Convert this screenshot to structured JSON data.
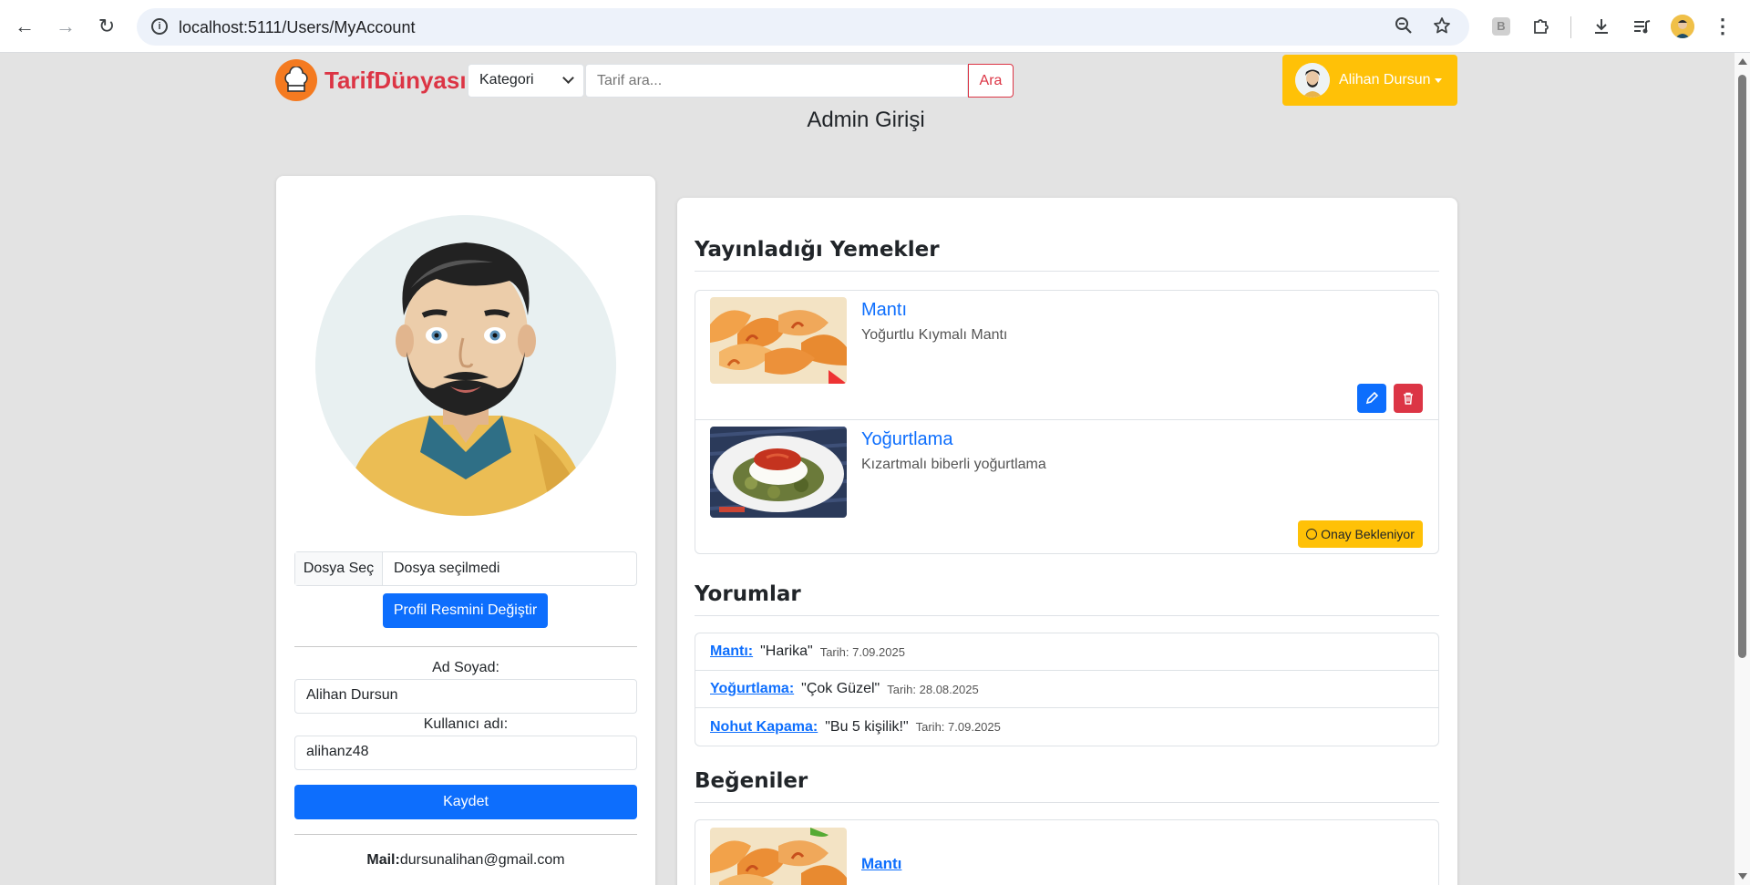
{
  "browser": {
    "url": "localhost:5111/Users/MyAccount"
  },
  "site": {
    "logo_text": "TarifDünyası",
    "category_select": "Kategori",
    "search_placeholder": "Tarif ara...",
    "search_button": "Ara",
    "user_name": "Alihan Dursun",
    "page_heading": "Admin Girişi"
  },
  "profile": {
    "file_button": "Dosya Seç",
    "file_status": "Dosya seçilmedi",
    "change_photo_button": "Profil Resmini Değiştir",
    "name_label": "Ad Soyad:",
    "name_value": "Alihan Dursun",
    "username_label": "Kullanıcı adı:",
    "username_value": "alihanz48",
    "save_button": "Kaydet",
    "mail_label": "Mail:",
    "mail_value": "dursunalihan@gmail.com"
  },
  "published": {
    "title": "Yayınladığı Yemekler",
    "items": [
      {
        "title": "Mantı",
        "desc": "Yoğurtlu Kıymalı Mantı"
      },
      {
        "title": "Yoğurtlama",
        "desc": "Kızartmalı biberli yoğurtlama",
        "status": "Onay Bekleniyor"
      }
    ]
  },
  "comments": {
    "title": "Yorumlar",
    "items": [
      {
        "recipe": "Mantı:",
        "text": "\"Harika\"",
        "date": "Tarih: 7.09.2025"
      },
      {
        "recipe": "Yoğurtlama:",
        "text": "\"Çok Güzel\"",
        "date": "Tarih: 28.08.2025"
      },
      {
        "recipe": "Nohut Kapama:",
        "text": "\"Bu 5 kişilik!\"",
        "date": "Tarih: 7.09.2025"
      }
    ]
  },
  "likes": {
    "title": "Beğeniler",
    "items": [
      {
        "title": "Mantı"
      }
    ]
  },
  "colors": {
    "primary": "#0d6efd",
    "danger": "#dc3545",
    "warning": "#ffc107",
    "logo_orange": "#f47a20",
    "page_bg": "#e3e3e3"
  }
}
